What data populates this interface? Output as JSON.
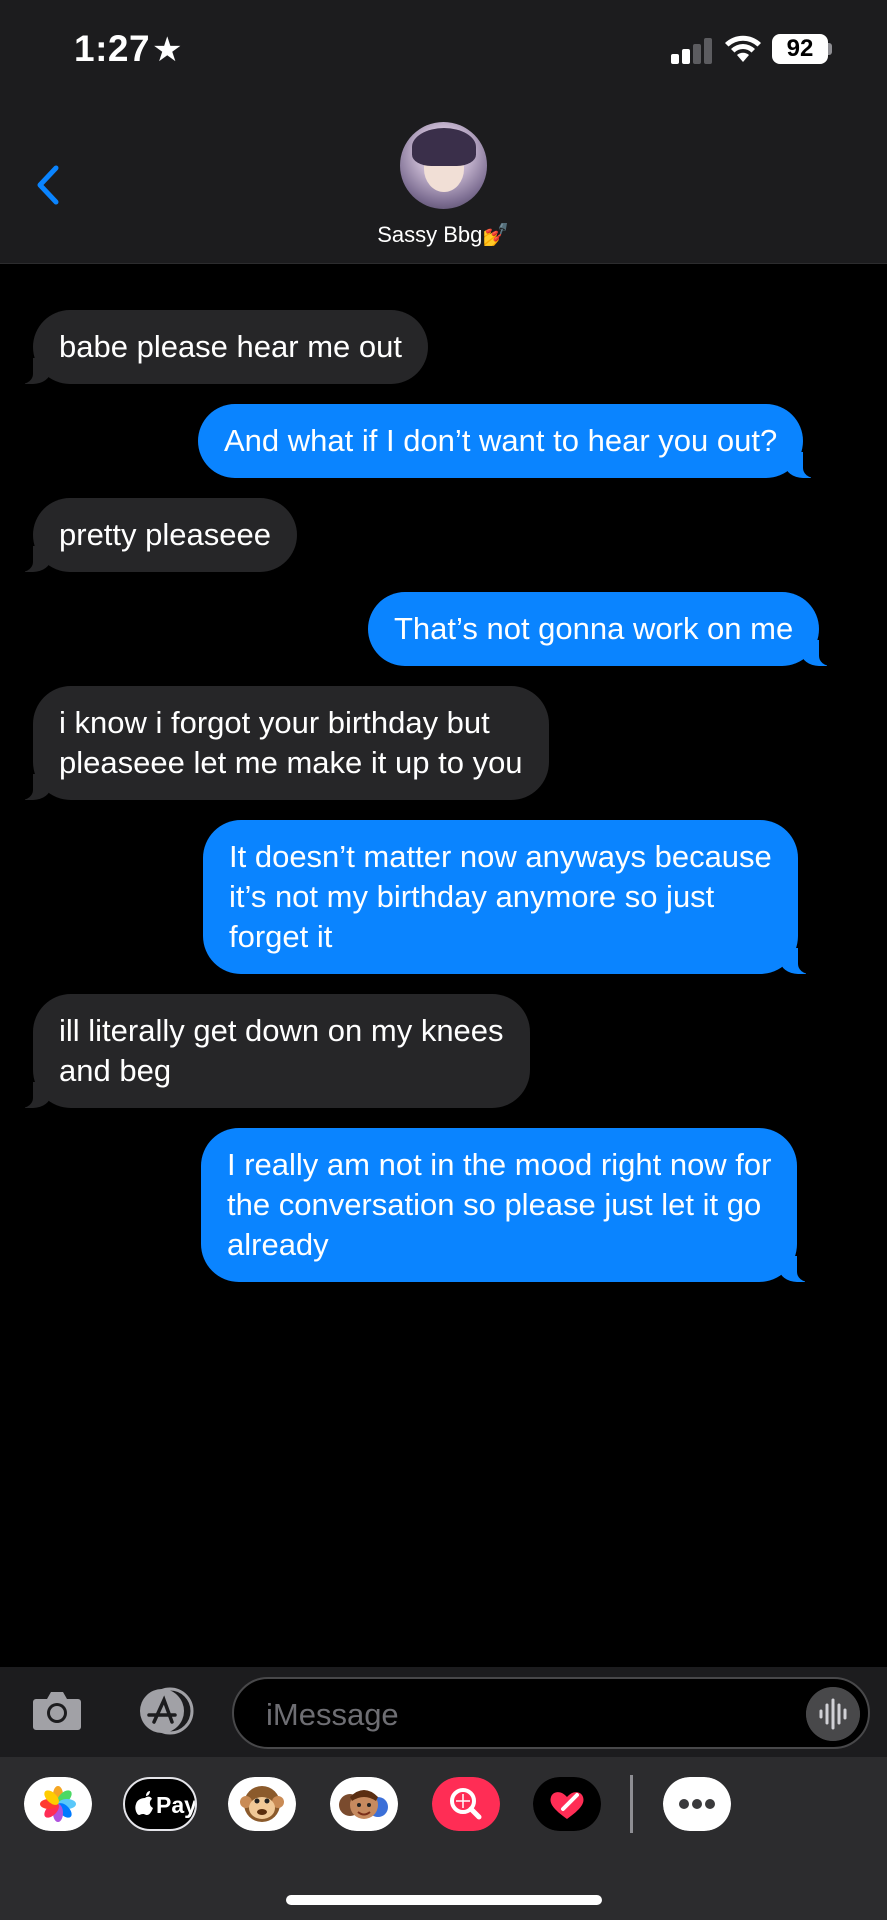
{
  "status_bar": {
    "time": "1:27",
    "battery": "92"
  },
  "header": {
    "contact_name": "Sassy Bbg💅"
  },
  "messages": [
    {
      "dir": "in",
      "text": "babe please hear me out"
    },
    {
      "dir": "out",
      "text": "And what if I don’t want to hear you out?"
    },
    {
      "dir": "in",
      "text": "pretty pleaseee"
    },
    {
      "dir": "out",
      "text": "That’s not gonna work on me"
    },
    {
      "dir": "in",
      "text": "i know i forgot your birthday but\npleaseee let me make it up to you"
    },
    {
      "dir": "out",
      "text": "It doesn’t matter now anyways because\nit’s not my birthday anymore so just\nforget it"
    },
    {
      "dir": "in",
      "text": "ill literally get down on my knees\nand beg"
    },
    {
      "dir": "out",
      "text": "I really am not in the mood right now for\nthe conversation so please just let it go\nalready"
    }
  ],
  "input": {
    "placeholder": "iMessage"
  },
  "drawer": {
    "apple_pay_label": "Pay"
  },
  "colors": {
    "outgoing": "#0a84ff",
    "incoming": "#262628",
    "background": "#000000",
    "bar": "#1c1c1e"
  },
  "icons": [
    "star-icon",
    "signal-icon",
    "wifi-icon",
    "battery-icon",
    "back-chevron-icon",
    "camera-icon",
    "app-store-icon",
    "audio-waveform-icon",
    "photos-icon",
    "apple-pay-icon",
    "monkey-memoji-icon",
    "memoji-stickers-icon",
    "search-images-icon",
    "digital-touch-icon",
    "more-icon"
  ]
}
